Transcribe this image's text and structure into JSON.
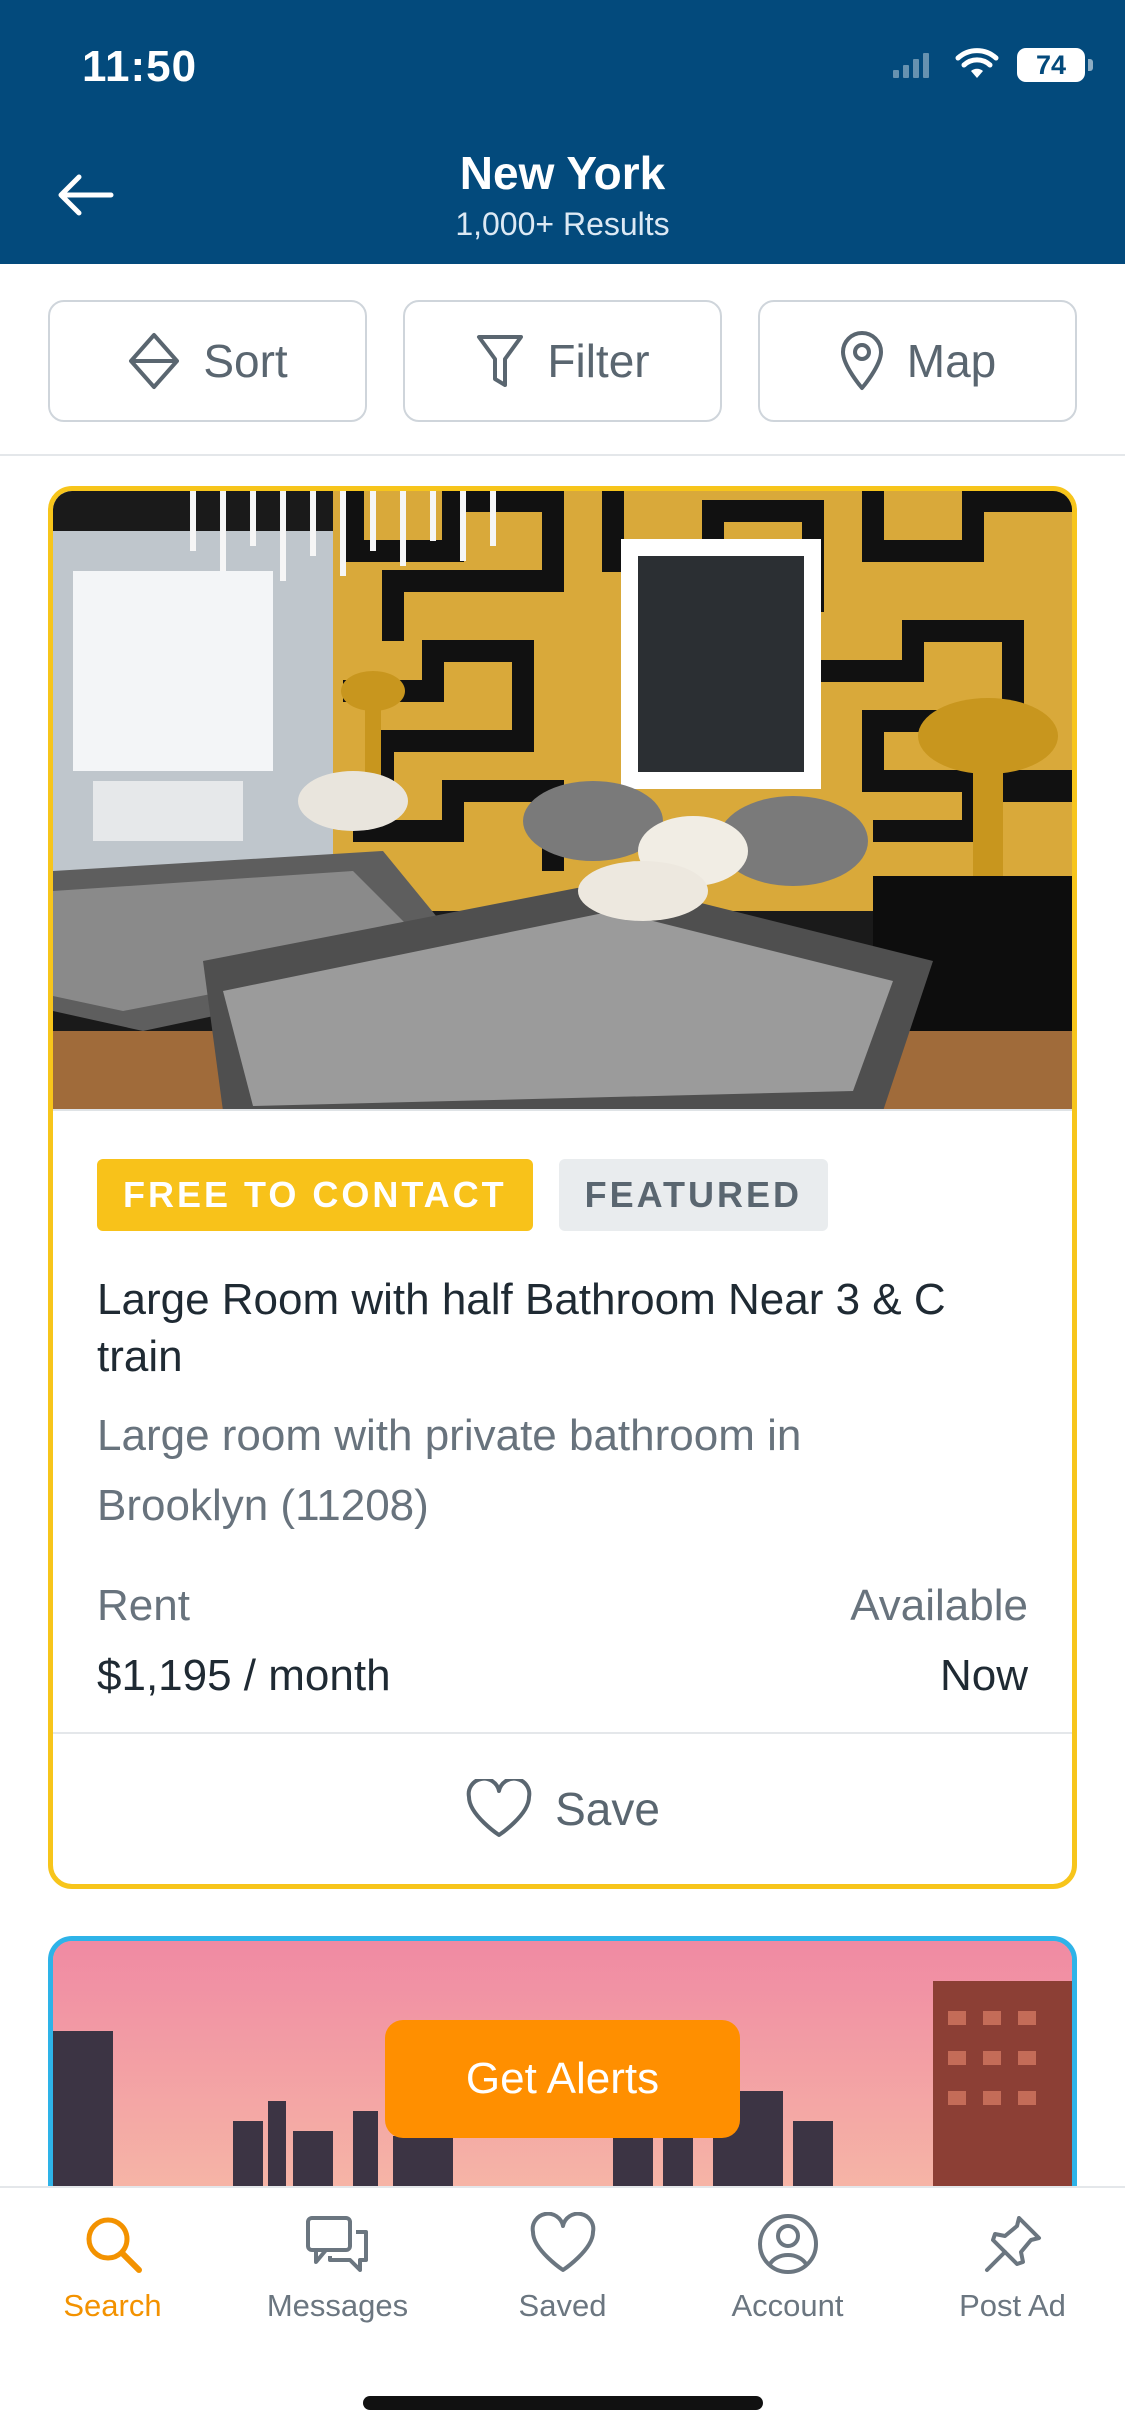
{
  "status_bar": {
    "time": "11:50",
    "battery": "74"
  },
  "header": {
    "title": "New York",
    "subtitle": "1,000+ Results"
  },
  "toolbar": {
    "sort": "Sort",
    "filter": "Filter",
    "map": "Map"
  },
  "listing": {
    "badges": [
      "FREE TO CONTACT",
      "FEATURED"
    ],
    "title": "Large Room with half Bathroom Near 3 & C train",
    "description": "Large room with private bathroom in Brooklyn (11208)",
    "rent_label": "Rent",
    "rent_value": "$1,195 / month",
    "available_label": "Available",
    "available_value": "Now",
    "save_label": "Save"
  },
  "alerts_button": "Get Alerts",
  "tabbar": {
    "items": [
      {
        "label": "Search",
        "icon": "search-icon",
        "active": true
      },
      {
        "label": "Messages",
        "icon": "messages-icon",
        "active": false
      },
      {
        "label": "Saved",
        "icon": "heart-icon",
        "active": false
      },
      {
        "label": "Account",
        "icon": "account-icon",
        "active": false
      },
      {
        "label": "Post Ad",
        "icon": "pin-icon",
        "active": false
      }
    ]
  },
  "colors": {
    "header_bg": "#034a7c",
    "accent_orange": "#ff8f00",
    "featured_border": "#f7c51b",
    "badge_yellow": "#f8c21a",
    "second_card_border": "#2eb3e8"
  }
}
